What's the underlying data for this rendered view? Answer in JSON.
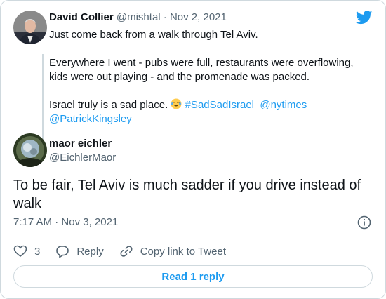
{
  "parent_tweet": {
    "name": "David Collier",
    "handle": "@mishtal",
    "separator": "·",
    "date": "Nov 2, 2021",
    "line1": "Just come back from a walk through Tel Aviv.",
    "line2": "Everywhere I went - pubs were full, restaurants were overflowing, kids were out playing - and the promenade was packed.",
    "line3_text": "Israel truly is a sad place.",
    "hashtag": "#SadSadIsrael",
    "mention1": "@nytimes",
    "mention2": "@PatrickKingsley",
    "emoji_icon": "face-with-tears-of-joy-emoji"
  },
  "reply_tweet": {
    "name": "maor eichler",
    "handle": "@EichlerMaor",
    "text": "To be fair, Tel Aviv is much sadder if you drive instead of walk",
    "time": "7:17 AM",
    "separator": "·",
    "date": "Nov 3, 2021"
  },
  "actions": {
    "like_count": "3",
    "reply_label": "Reply",
    "copy_link_label": "Copy link to Tweet"
  },
  "read_replies_label": "Read 1 reply",
  "colors": {
    "accent": "#1d9bf0",
    "secondary_text": "#536471",
    "border": "#cfd9de"
  }
}
